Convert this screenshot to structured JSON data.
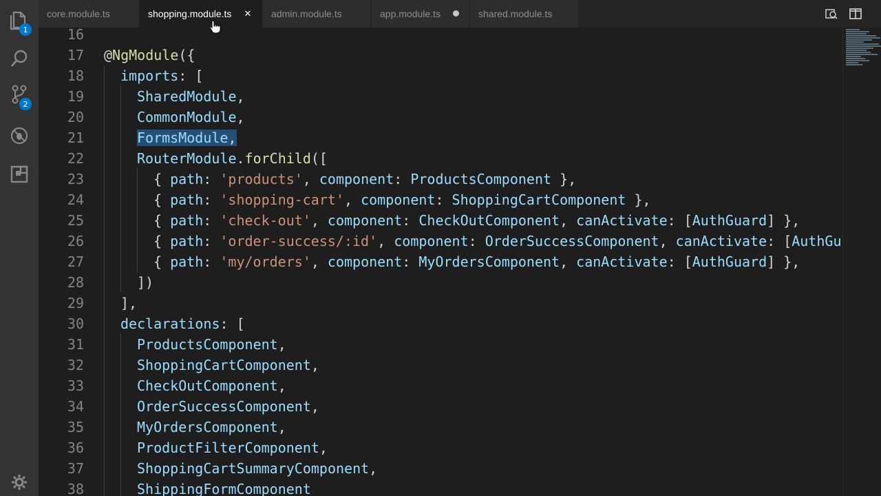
{
  "activity_bar": {
    "items": [
      {
        "name": "explorer",
        "icon": "files-icon",
        "badge": "1"
      },
      {
        "name": "search",
        "icon": "search-icon",
        "badge": ""
      },
      {
        "name": "source-control",
        "icon": "git-branch-icon",
        "badge": "2"
      },
      {
        "name": "debug",
        "icon": "debug-icon",
        "badge": ""
      },
      {
        "name": "extensions",
        "icon": "extensions-icon",
        "badge": ""
      }
    ],
    "settings_icon": "gear-icon"
  },
  "tabs": [
    {
      "label": "core.module.ts",
      "state": "inactive"
    },
    {
      "label": "shopping.module.ts",
      "state": "active"
    },
    {
      "label": "admin.module.ts",
      "state": "inactive"
    },
    {
      "label": "app.module.ts",
      "state": "dirty"
    },
    {
      "label": "shared.module.ts",
      "state": "inactive"
    }
  ],
  "tab_actions": [
    {
      "name": "open-changes-icon"
    },
    {
      "name": "split-editor-icon"
    }
  ],
  "editor": {
    "lines": [
      {
        "n": "16",
        "indent": 0,
        "tokens": []
      },
      {
        "n": "17",
        "indent": 0,
        "tokens": [
          {
            "t": "@",
            "c": "punc"
          },
          {
            "t": "NgModule",
            "c": "dec"
          },
          {
            "t": "({",
            "c": "punc"
          }
        ]
      },
      {
        "n": "18",
        "indent": 1,
        "tokens": [
          {
            "t": "imports",
            "c": "kw"
          },
          {
            "t": ": [",
            "c": "punc"
          }
        ]
      },
      {
        "n": "19",
        "indent": 2,
        "tokens": [
          {
            "t": "SharedModule",
            "c": "kw"
          },
          {
            "t": ",",
            "c": "punc"
          }
        ]
      },
      {
        "n": "20",
        "indent": 2,
        "tokens": [
          {
            "t": "CommonModule",
            "c": "kw"
          },
          {
            "t": ",",
            "c": "punc"
          }
        ]
      },
      {
        "n": "21",
        "indent": 2,
        "tokens": [
          {
            "t": "FormsModule",
            "c": "kw",
            "sel": true
          },
          {
            "t": ",",
            "c": "punc",
            "sel": true
          }
        ]
      },
      {
        "n": "22",
        "indent": 2,
        "tokens": [
          {
            "t": "RouterModule",
            "c": "kw"
          },
          {
            "t": ".",
            "c": "punc"
          },
          {
            "t": "forChild",
            "c": "dec"
          },
          {
            "t": "([",
            "c": "punc"
          }
        ]
      },
      {
        "n": "23",
        "indent": 3,
        "tokens": [
          {
            "t": "{ ",
            "c": "punc"
          },
          {
            "t": "path",
            "c": "kw"
          },
          {
            "t": ": ",
            "c": "punc"
          },
          {
            "t": "'products'",
            "c": "str"
          },
          {
            "t": ", ",
            "c": "punc"
          },
          {
            "t": "component",
            "c": "kw"
          },
          {
            "t": ": ",
            "c": "punc"
          },
          {
            "t": "ProductsComponent",
            "c": "kw"
          },
          {
            "t": " },",
            "c": "punc"
          }
        ]
      },
      {
        "n": "24",
        "indent": 3,
        "tokens": [
          {
            "t": "{ ",
            "c": "punc"
          },
          {
            "t": "path",
            "c": "kw"
          },
          {
            "t": ": ",
            "c": "punc"
          },
          {
            "t": "'shopping-cart'",
            "c": "str"
          },
          {
            "t": ", ",
            "c": "punc"
          },
          {
            "t": "component",
            "c": "kw"
          },
          {
            "t": ": ",
            "c": "punc"
          },
          {
            "t": "ShoppingCartComponent",
            "c": "kw"
          },
          {
            "t": " },",
            "c": "punc"
          }
        ]
      },
      {
        "n": "25",
        "indent": 3,
        "tokens": [
          {
            "t": "{ ",
            "c": "punc"
          },
          {
            "t": "path",
            "c": "kw"
          },
          {
            "t": ": ",
            "c": "punc"
          },
          {
            "t": "'check-out'",
            "c": "str"
          },
          {
            "t": ", ",
            "c": "punc"
          },
          {
            "t": "component",
            "c": "kw"
          },
          {
            "t": ": ",
            "c": "punc"
          },
          {
            "t": "CheckOutComponent",
            "c": "kw"
          },
          {
            "t": ", ",
            "c": "punc"
          },
          {
            "t": "canActivate",
            "c": "kw"
          },
          {
            "t": ": [",
            "c": "punc"
          },
          {
            "t": "AuthGuard",
            "c": "kw"
          },
          {
            "t": "] },",
            "c": "punc"
          }
        ]
      },
      {
        "n": "26",
        "indent": 3,
        "tokens": [
          {
            "t": "{ ",
            "c": "punc"
          },
          {
            "t": "path",
            "c": "kw"
          },
          {
            "t": ": ",
            "c": "punc"
          },
          {
            "t": "'order-success/:id'",
            "c": "str"
          },
          {
            "t": ", ",
            "c": "punc"
          },
          {
            "t": "component",
            "c": "kw"
          },
          {
            "t": ": ",
            "c": "punc"
          },
          {
            "t": "OrderSuccessComponent",
            "c": "kw"
          },
          {
            "t": ", ",
            "c": "punc"
          },
          {
            "t": "canActivate",
            "c": "kw"
          },
          {
            "t": ": [",
            "c": "punc"
          },
          {
            "t": "AuthGu",
            "c": "kw"
          }
        ]
      },
      {
        "n": "27",
        "indent": 3,
        "tokens": [
          {
            "t": "{ ",
            "c": "punc"
          },
          {
            "t": "path",
            "c": "kw"
          },
          {
            "t": ": ",
            "c": "punc"
          },
          {
            "t": "'my/orders'",
            "c": "str"
          },
          {
            "t": ", ",
            "c": "punc"
          },
          {
            "t": "component",
            "c": "kw"
          },
          {
            "t": ": ",
            "c": "punc"
          },
          {
            "t": "MyOrdersComponent",
            "c": "kw"
          },
          {
            "t": ", ",
            "c": "punc"
          },
          {
            "t": "canActivate",
            "c": "kw"
          },
          {
            "t": ": [",
            "c": "punc"
          },
          {
            "t": "AuthGuard",
            "c": "kw"
          },
          {
            "t": "] },",
            "c": "punc"
          }
        ]
      },
      {
        "n": "28",
        "indent": 2,
        "tokens": [
          {
            "t": "])",
            "c": "punc"
          }
        ]
      },
      {
        "n": "29",
        "indent": 1,
        "tokens": [
          {
            "t": "],",
            "c": "punc"
          }
        ]
      },
      {
        "n": "30",
        "indent": 1,
        "tokens": [
          {
            "t": "declarations",
            "c": "kw"
          },
          {
            "t": ": [",
            "c": "punc"
          }
        ]
      },
      {
        "n": "31",
        "indent": 2,
        "tokens": [
          {
            "t": "ProductsComponent",
            "c": "kw"
          },
          {
            "t": ",",
            "c": "punc"
          }
        ]
      },
      {
        "n": "32",
        "indent": 2,
        "tokens": [
          {
            "t": "ShoppingCartComponent",
            "c": "kw"
          },
          {
            "t": ",",
            "c": "punc"
          }
        ]
      },
      {
        "n": "33",
        "indent": 2,
        "tokens": [
          {
            "t": "CheckOutComponent",
            "c": "kw"
          },
          {
            "t": ",",
            "c": "punc"
          }
        ]
      },
      {
        "n": "34",
        "indent": 2,
        "tokens": [
          {
            "t": "OrderSuccessComponent",
            "c": "kw"
          },
          {
            "t": ",",
            "c": "punc"
          }
        ]
      },
      {
        "n": "35",
        "indent": 2,
        "tokens": [
          {
            "t": "MyOrdersComponent",
            "c": "kw"
          },
          {
            "t": ",",
            "c": "punc"
          }
        ]
      },
      {
        "n": "36",
        "indent": 2,
        "tokens": [
          {
            "t": "ProductFilterComponent",
            "c": "kw"
          },
          {
            "t": ",",
            "c": "punc"
          }
        ]
      },
      {
        "n": "37",
        "indent": 2,
        "tokens": [
          {
            "t": "ShoppingCartSummaryComponent",
            "c": "kw"
          },
          {
            "t": ",",
            "c": "punc"
          }
        ]
      },
      {
        "n": "38",
        "indent": 2,
        "tokens": [
          {
            "t": "ShippingFormComponent",
            "c": "kw"
          }
        ]
      }
    ]
  },
  "colors": {
    "keyword": "#9cdcfe",
    "string": "#ce9178",
    "function": "#dcdcaa",
    "selection": "#264f78",
    "badge": "#007acc"
  }
}
